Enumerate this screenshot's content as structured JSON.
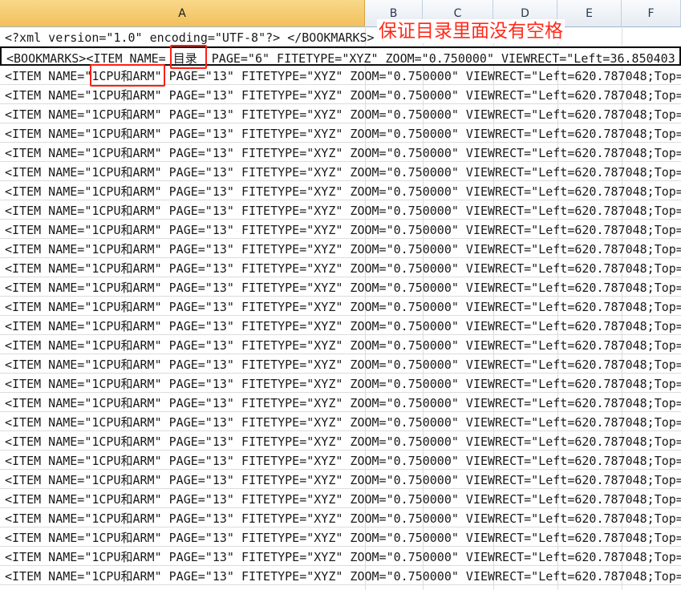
{
  "spreadsheet": {
    "columns": [
      "A",
      "B",
      "C",
      "D",
      "E",
      "F"
    ],
    "selected_column": "A",
    "rows": [
      "<?xml version=\"1.0\" encoding=\"UTF-8\"?> </BOOKMARKS>",
      "<BOOKMARKS><ITEM NAME= 目录  PAGE=\"6\" FITETYPE=\"XYZ\" ZOOM=\"0.750000\" VIEWRECT=\"Left=36.850403",
      "<ITEM NAME=\"1CPU和ARM\" PAGE=\"13\" FITETYPE=\"XYZ\" ZOOM=\"0.750000\" VIEWRECT=\"Left=620.787048;Top=",
      "<ITEM NAME=\"1CPU和ARM\" PAGE=\"13\" FITETYPE=\"XYZ\" ZOOM=\"0.750000\" VIEWRECT=\"Left=620.787048;Top=",
      "<ITEM NAME=\"1CPU和ARM\" PAGE=\"13\" FITETYPE=\"XYZ\" ZOOM=\"0.750000\" VIEWRECT=\"Left=620.787048;Top=",
      "<ITEM NAME=\"1CPU和ARM\" PAGE=\"13\" FITETYPE=\"XYZ\" ZOOM=\"0.750000\" VIEWRECT=\"Left=620.787048;Top=",
      "<ITEM NAME=\"1CPU和ARM\" PAGE=\"13\" FITETYPE=\"XYZ\" ZOOM=\"0.750000\" VIEWRECT=\"Left=620.787048;Top=",
      "<ITEM NAME=\"1CPU和ARM\" PAGE=\"13\" FITETYPE=\"XYZ\" ZOOM=\"0.750000\" VIEWRECT=\"Left=620.787048;Top=",
      "<ITEM NAME=\"1CPU和ARM\" PAGE=\"13\" FITETYPE=\"XYZ\" ZOOM=\"0.750000\" VIEWRECT=\"Left=620.787048;Top=",
      "<ITEM NAME=\"1CPU和ARM\" PAGE=\"13\" FITETYPE=\"XYZ\" ZOOM=\"0.750000\" VIEWRECT=\"Left=620.787048;Top=",
      "<ITEM NAME=\"1CPU和ARM\" PAGE=\"13\" FITETYPE=\"XYZ\" ZOOM=\"0.750000\" VIEWRECT=\"Left=620.787048;Top=",
      "<ITEM NAME=\"1CPU和ARM\" PAGE=\"13\" FITETYPE=\"XYZ\" ZOOM=\"0.750000\" VIEWRECT=\"Left=620.787048;Top=",
      "<ITEM NAME=\"1CPU和ARM\" PAGE=\"13\" FITETYPE=\"XYZ\" ZOOM=\"0.750000\" VIEWRECT=\"Left=620.787048;Top=",
      "<ITEM NAME=\"1CPU和ARM\" PAGE=\"13\" FITETYPE=\"XYZ\" ZOOM=\"0.750000\" VIEWRECT=\"Left=620.787048;Top=",
      "<ITEM NAME=\"1CPU和ARM\" PAGE=\"13\" FITETYPE=\"XYZ\" ZOOM=\"0.750000\" VIEWRECT=\"Left=620.787048;Top=",
      "<ITEM NAME=\"1CPU和ARM\" PAGE=\"13\" FITETYPE=\"XYZ\" ZOOM=\"0.750000\" VIEWRECT=\"Left=620.787048;Top=",
      "<ITEM NAME=\"1CPU和ARM\" PAGE=\"13\" FITETYPE=\"XYZ\" ZOOM=\"0.750000\" VIEWRECT=\"Left=620.787048;Top=",
      "<ITEM NAME=\"1CPU和ARM\" PAGE=\"13\" FITETYPE=\"XYZ\" ZOOM=\"0.750000\" VIEWRECT=\"Left=620.787048;Top=",
      "<ITEM NAME=\"1CPU和ARM\" PAGE=\"13\" FITETYPE=\"XYZ\" ZOOM=\"0.750000\" VIEWRECT=\"Left=620.787048;Top=",
      "<ITEM NAME=\"1CPU和ARM\" PAGE=\"13\" FITETYPE=\"XYZ\" ZOOM=\"0.750000\" VIEWRECT=\"Left=620.787048;Top=",
      "<ITEM NAME=\"1CPU和ARM\" PAGE=\"13\" FITETYPE=\"XYZ\" ZOOM=\"0.750000\" VIEWRECT=\"Left=620.787048;Top=",
      "<ITEM NAME=\"1CPU和ARM\" PAGE=\"13\" FITETYPE=\"XYZ\" ZOOM=\"0.750000\" VIEWRECT=\"Left=620.787048;Top=",
      "<ITEM NAME=\"1CPU和ARM\" PAGE=\"13\" FITETYPE=\"XYZ\" ZOOM=\"0.750000\" VIEWRECT=\"Left=620.787048;Top=",
      "<ITEM NAME=\"1CPU和ARM\" PAGE=\"13\" FITETYPE=\"XYZ\" ZOOM=\"0.750000\" VIEWRECT=\"Left=620.787048;Top=",
      "<ITEM NAME=\"1CPU和ARM\" PAGE=\"13\" FITETYPE=\"XYZ\" ZOOM=\"0.750000\" VIEWRECT=\"Left=620.787048;Top=",
      "<ITEM NAME=\"1CPU和ARM\" PAGE=\"13\" FITETYPE=\"XYZ\" ZOOM=\"0.750000\" VIEWRECT=\"Left=620.787048;Top=",
      "<ITEM NAME=\"1CPU和ARM\" PAGE=\"13\" FITETYPE=\"XYZ\" ZOOM=\"0.750000\" VIEWRECT=\"Left=620.787048;Top=",
      "<ITEM NAME=\"1CPU和ARM\" PAGE=\"13\" FITETYPE=\"XYZ\" ZOOM=\"0.750000\" VIEWRECT=\"Left=620.787048;Top=",
      "<ITEM NAME=\"1CPU和ARM\" PAGE=\"13\" FITETYPE=\"XYZ\" ZOOM=\"0.750000\" VIEWRECT=\"Left=620.787048;Top="
    ]
  },
  "annotation": {
    "note": "保证目录里面没有空格",
    "color": "#ff2a1a"
  }
}
